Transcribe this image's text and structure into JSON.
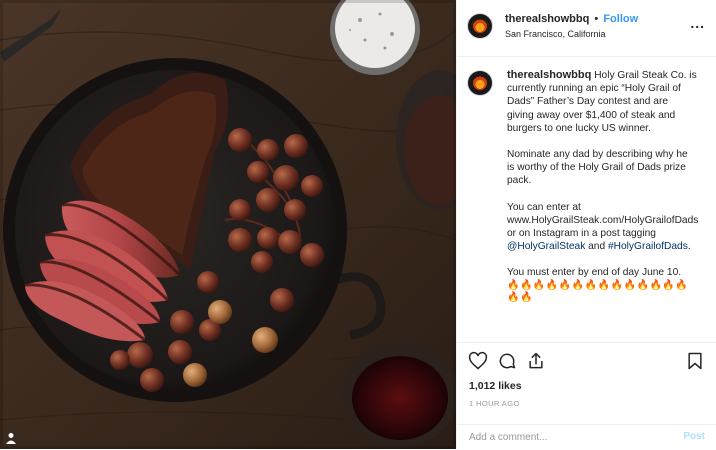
{
  "post": {
    "username": "therealshowbbq",
    "separator": "•",
    "follow_label": "Follow",
    "location": "San Francisco, California",
    "more_label": "...",
    "caption": {
      "username": "therealshowbbq",
      "p1": "Holy Grail Steak Co. is currently running an epic “Holy Grail of Dads” Father’s Day contest and are giving away over $1,400 of steak and burgers to one lucky US winner.",
      "p2": "Nominate any dad by describing why he is worthy of the Holy Grail of Dads prize pack.",
      "p3_a": "You can enter at www.HolyGrailSteak.com/HolyGrailofDads or on Instagram in a post tagging ",
      "p3_tag1": "@HolyGrailSteak",
      "p3_b": " and ",
      "p3_tag2": "#HolyGrailofDads",
      "p3_c": ".",
      "p4": "You must enter by end of day June 10.",
      "emojis": "🔥🔥🔥🔥🔥🔥🔥🔥🔥🔥🔥🔥🔥🔥🔥🔥"
    },
    "likes": "1,012 likes",
    "time": "1 HOUR AGO",
    "comment_placeholder": "Add a comment...",
    "post_label": "Post"
  },
  "colors": {
    "link": "#3897f0",
    "hashtag": "#003569",
    "post_disabled": "#b2dffc"
  }
}
